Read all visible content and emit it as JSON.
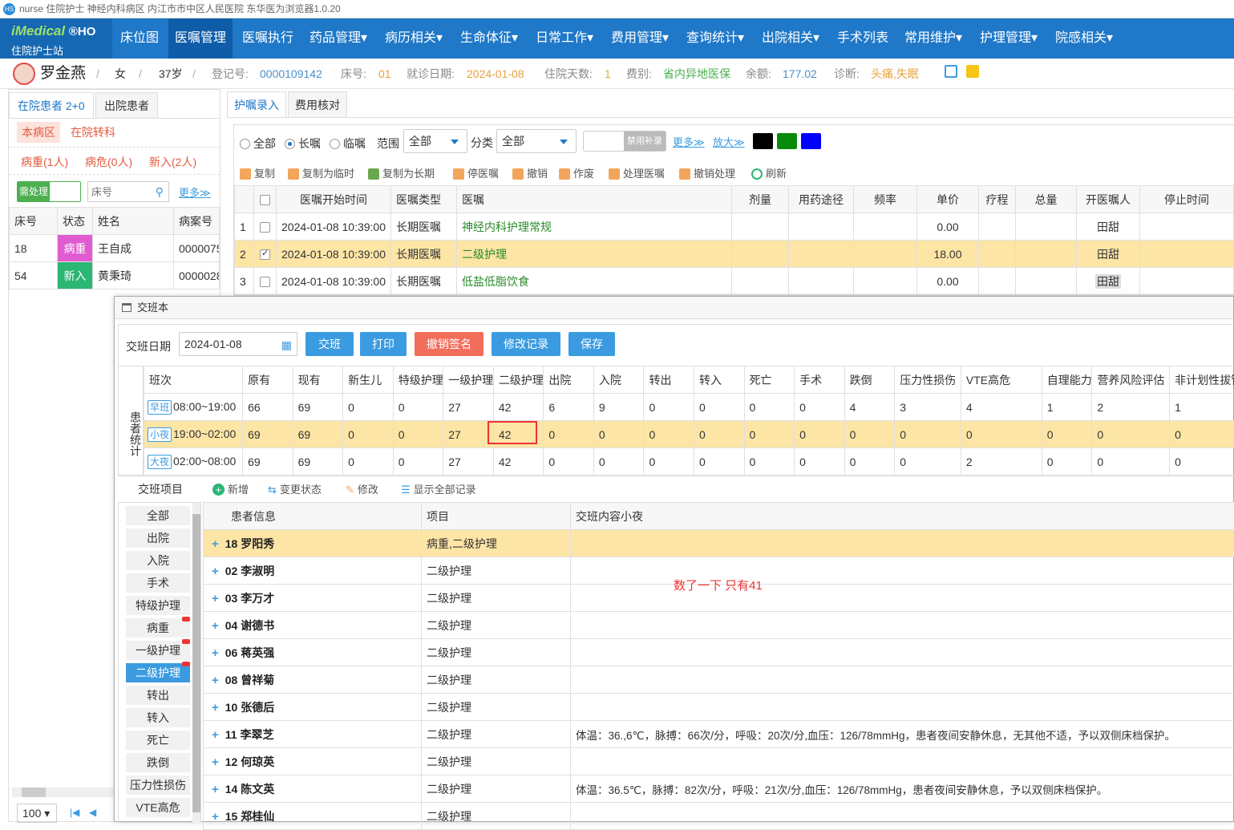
{
  "window": {
    "title": "nurse 住院护士 神经内科病区 内江市市中区人民医院  东华医为浏览器1.0.20"
  },
  "brand": {
    "line1_a": "iMedical",
    "line1_b": "®HO",
    "line2": "住院护士站"
  },
  "nav": [
    "床位图",
    "医嘱管理",
    "医嘱执行",
    "药品管理▾",
    "病历相关▾",
    "生命体征▾",
    "日常工作▾",
    "费用管理▾",
    "查询统计▾",
    "出院相关▾",
    "手术列表",
    "常用维护▾",
    "护理管理▾",
    "院感相关▾"
  ],
  "patient": {
    "name": "罗金燕",
    "sex": "女",
    "age": "37岁",
    "reg_label": "登记号:",
    "reg": "0000109142",
    "bed_label": "床号:",
    "bed": "01",
    "visit_label": "就诊日期:",
    "visit": "2024-01-08",
    "days_label": "住院天数:",
    "days": "1",
    "fee_label": "费别:",
    "fee": "省内异地医保",
    "bal_label": "余额:",
    "bal": "177.02",
    "diag_label": "诊断:",
    "diag": "头痛,失眠"
  },
  "left": {
    "tab1": "在院患者 2+0",
    "tab2": "出院患者",
    "ward": "本病区",
    "transfer": "在院转科",
    "s1": "病重(1人)",
    "s2": "病危(0人)",
    "s3": "新入(2人)",
    "todo": "需处理",
    "bed_placeholder": "床号",
    "more": "更多≫",
    "headers": [
      "床号",
      "状态",
      "姓名",
      "病案号"
    ],
    "rows": [
      {
        "bed": "18",
        "status": "病重",
        "name": "王自成",
        "case": "0000075"
      },
      {
        "bed": "54",
        "status": "新入",
        "name": "黄秉琦",
        "case": "0000028"
      }
    ],
    "pagesize": "100"
  },
  "orders": {
    "tab1": "护嘱录入",
    "tab2": "费用核对",
    "f_all": "全部",
    "f_long": "长嘱",
    "f_temp": "临嘱",
    "range_label": "范围",
    "range": "全部",
    "cat_label": "分类",
    "cat": "全部",
    "disabled_btn": "禁用补录",
    "more": "更多≫",
    "zoom": "放大≫",
    "tools": [
      "复制",
      "复制为临时",
      "复制为长期",
      "停医嘱",
      "撤销",
      "作废",
      "处理医嘱",
      "撤销处理",
      "刷新"
    ],
    "headers": [
      "",
      "医嘱开始时间",
      "医嘱类型",
      "医嘱",
      "剂量",
      "用药途径",
      "频率",
      "单价",
      "疗程",
      "总量",
      "开医嘱人",
      "停止时间"
    ],
    "rows": [
      {
        "no": "1",
        "time": "2024-01-08 10:39:00",
        "type": "长期医嘱",
        "order": "神经内科护理常规",
        "price": "0.00",
        "doctor": "田甜"
      },
      {
        "no": "2",
        "time": "2024-01-08 10:39:00",
        "type": "长期医嘱",
        "order": "二级护理",
        "price": "18.00",
        "doctor": "田甜"
      },
      {
        "no": "3",
        "time": "2024-01-08 10:39:00",
        "type": "长期医嘱",
        "order": "低盐低脂饮食",
        "price": "0.00",
        "doctor": "田甜"
      }
    ]
  },
  "dialog": {
    "title": "交班本",
    "date_label": "交班日期",
    "date": "2024-01-08",
    "buttons": [
      "交班",
      "打印",
      "撤销签名",
      "修改记录",
      "保存"
    ],
    "side_label": "患者统计",
    "stat_headers": [
      "班次",
      "原有",
      "现有",
      "新生儿",
      "特级护理",
      "一级护理",
      "二级护理",
      "出院",
      "入院",
      "转出",
      "转入",
      "死亡",
      "手术",
      "跌倒",
      "压力性损伤",
      "VTE高危",
      "自理能力",
      "营养风险评估",
      "非计划性拔管"
    ],
    "stat_rows": [
      {
        "tag": "早班",
        "time": "08:00~19:00",
        "vals": [
          "66",
          "69",
          "0",
          "0",
          "27",
          "42",
          "6",
          "9",
          "0",
          "0",
          "0",
          "0",
          "4",
          "3",
          "4",
          "1",
          "2",
          "1"
        ]
      },
      {
        "tag": "小夜",
        "time": "19:00~02:00",
        "vals": [
          "69",
          "69",
          "0",
          "0",
          "27",
          "42",
          "0",
          "0",
          "0",
          "0",
          "0",
          "0",
          "0",
          "0",
          "0",
          "0",
          "0",
          "0"
        ]
      },
      {
        "tag": "大夜",
        "time": "02:00~08:00",
        "vals": [
          "69",
          "69",
          "0",
          "0",
          "27",
          "42",
          "0",
          "0",
          "0",
          "0",
          "0",
          "0",
          "0",
          "0",
          "2",
          "0",
          "0",
          "0"
        ]
      }
    ],
    "items_label": "交班项目",
    "tools": [
      "新增",
      "变更状态",
      "修改",
      "显示全部记录"
    ],
    "side_items": [
      "全部",
      "出院",
      "入院",
      "手术",
      "特级护理",
      "病重",
      "一级护理",
      "二级护理",
      "转出",
      "转入",
      "死亡",
      "跌倒",
      "压力性损伤",
      "VTE高危"
    ],
    "list_headers": [
      "患者信息",
      "项目",
      "交班内容小夜"
    ],
    "list_rows": [
      {
        "p": "18 罗阳秀",
        "i": "病重,二级护理",
        "c": ""
      },
      {
        "p": "02 李淑明",
        "i": "二级护理",
        "c": ""
      },
      {
        "p": "03 李万才",
        "i": "二级护理",
        "c": ""
      },
      {
        "p": "04 谢德书",
        "i": "二级护理",
        "c": ""
      },
      {
        "p": "06 蒋英强",
        "i": "二级护理",
        "c": ""
      },
      {
        "p": "08 曾祥菊",
        "i": "二级护理",
        "c": ""
      },
      {
        "p": "10 张德后",
        "i": "二级护理",
        "c": ""
      },
      {
        "p": "11 李翠芝",
        "i": "二级护理",
        "c": "体温：36.,6℃，脉搏：66次/分，呼吸：20次/分,血压：126/78mmHg，患者夜间安静休息，无其他不适，予以双侧床档保护。"
      },
      {
        "p": "12 何琼英",
        "i": "二级护理",
        "c": ""
      },
      {
        "p": "14 陈文英",
        "i": "二级护理",
        "c": "体温：36.5℃，脉搏：82次/分，呼吸：21次/分,血压：126/78mmHg，患者夜间安静休息，予以双侧床档保护。"
      },
      {
        "p": "15 郑桂仙",
        "i": "二级护理",
        "c": ""
      }
    ],
    "annotation": "数了一下 只有41"
  }
}
